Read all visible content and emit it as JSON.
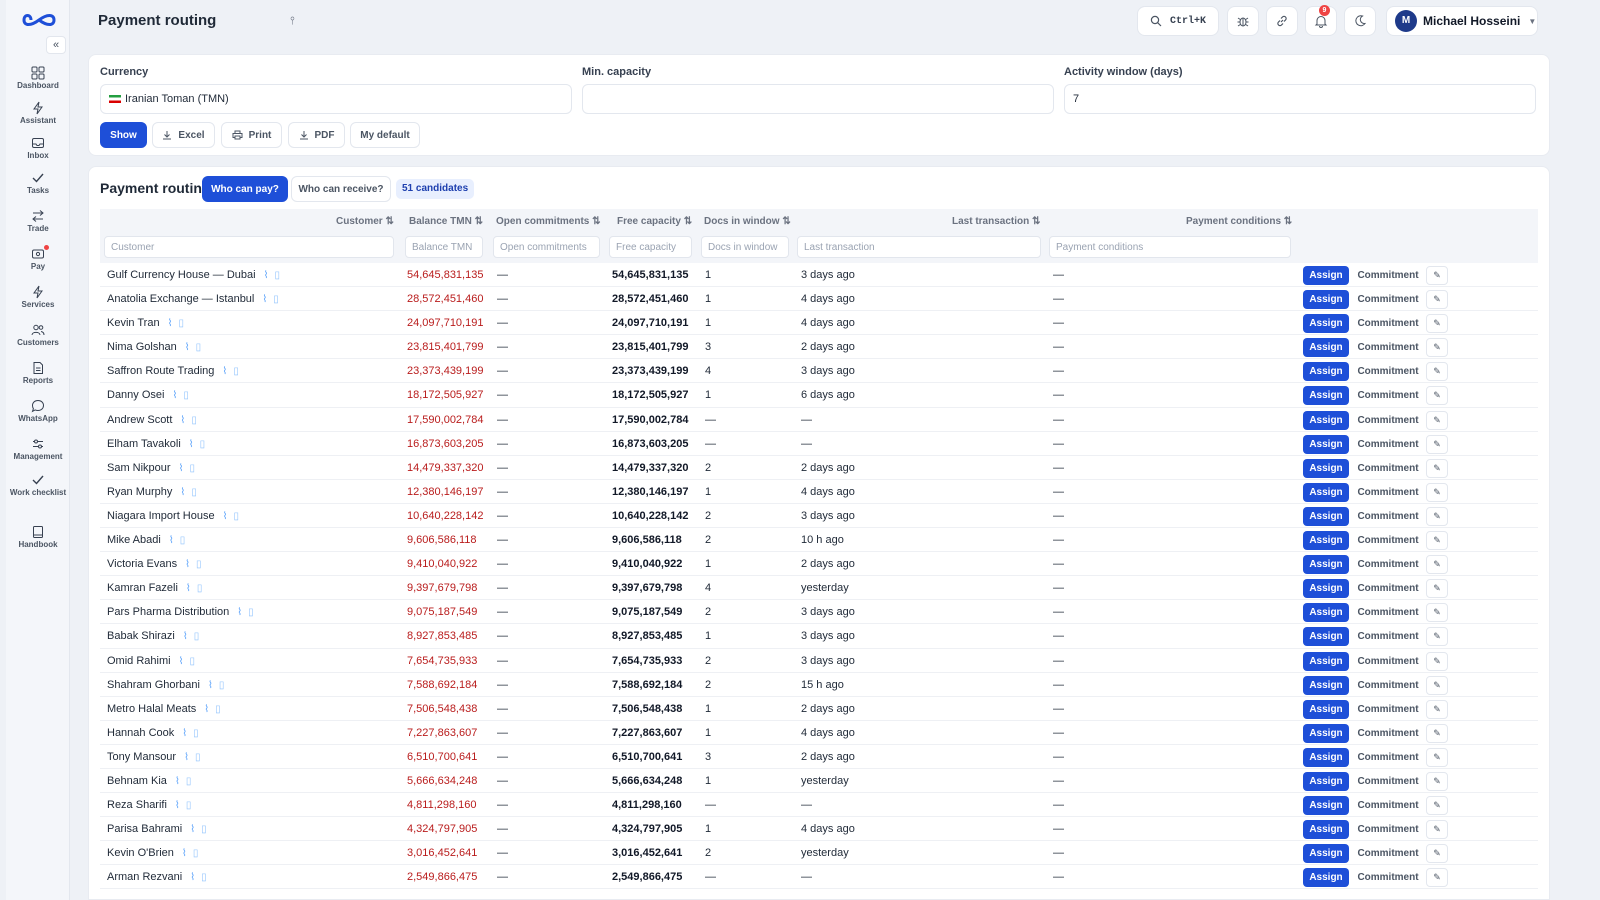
{
  "app": {
    "page_title": "Payment routing"
  },
  "sidebar": {
    "items": [
      {
        "label": "Dashboard",
        "icon": "dashboard-icon"
      },
      {
        "label": "Assistant",
        "icon": "bolt-icon"
      },
      {
        "label": "Inbox",
        "icon": "inbox-icon"
      },
      {
        "label": "Tasks",
        "icon": "check-icon"
      },
      {
        "label": "Trade",
        "icon": "swap-icon"
      },
      {
        "label": "Pay",
        "icon": "wallet-icon"
      },
      {
        "label": "Services",
        "icon": "bolt-icon"
      },
      {
        "label": "Customers",
        "icon": "users-icon"
      },
      {
        "label": "Reports",
        "icon": "report-icon"
      },
      {
        "label": "WhatsApp",
        "icon": "chat-icon"
      },
      {
        "label": "Management",
        "icon": "sliders-icon"
      },
      {
        "label": "Work checklist",
        "icon": "check-icon"
      },
      {
        "label": "Handbook",
        "icon": "book-icon"
      }
    ]
  },
  "header": {
    "search_shortcut": "Ctrl+K",
    "notification_count": "9",
    "user": {
      "initial": "M",
      "name": "Michael Hosseini"
    }
  },
  "filters": {
    "currency_label": "Currency",
    "currency_value": "Iranian Toman (TMN)",
    "min_capacity_label": "Min. capacity",
    "min_capacity_value": "",
    "activity_label": "Activity window (days)",
    "activity_value": "7",
    "buttons": {
      "show": "Show",
      "excel": "Excel",
      "print": "Print",
      "pdf": "PDF",
      "default": "My default"
    }
  },
  "table": {
    "title": "Payment routing",
    "tab_active": "Who can pay?",
    "tab_inactive": "Who can receive?",
    "candidates": "51 candidates",
    "columns": {
      "customer": "Customer ⇅",
      "balance": "Balance TMN ⇅",
      "open": "Open commitments ⇅",
      "free": "Free capacity ⇅",
      "docs": "Docs in window ⇅",
      "last": "Last transaction ⇅",
      "cond": "Payment conditions ⇅"
    },
    "placeholders": {
      "customer": "Customer",
      "balance": "Balance TMN",
      "open": "Open commitments",
      "free": "Free capacity",
      "docs": "Docs in window",
      "last": "Last transaction",
      "cond": "Payment conditions"
    },
    "action_labels": {
      "assign": "Assign",
      "commitment": "Commitment",
      "edit": "✎"
    },
    "rows": [
      {
        "name": "Gulf Currency House — Dubai",
        "balance": "54,645,831,135",
        "open": "—",
        "free": "54,645,831,135",
        "docs": "1",
        "last": "3 days ago",
        "cond": "—"
      },
      {
        "name": "Anatolia Exchange — Istanbul",
        "balance": "28,572,451,460",
        "open": "—",
        "free": "28,572,451,460",
        "docs": "1",
        "last": "4 days ago",
        "cond": "—"
      },
      {
        "name": "Kevin Tran",
        "balance": "24,097,710,191",
        "open": "—",
        "free": "24,097,710,191",
        "docs": "1",
        "last": "4 days ago",
        "cond": "—"
      },
      {
        "name": "Nima Golshan",
        "balance": "23,815,401,799",
        "open": "—",
        "free": "23,815,401,799",
        "docs": "3",
        "last": "2 days ago",
        "cond": "—"
      },
      {
        "name": "Saffron Route Trading",
        "balance": "23,373,439,199",
        "open": "—",
        "free": "23,373,439,199",
        "docs": "4",
        "last": "3 days ago",
        "cond": "—"
      },
      {
        "name": "Danny Osei",
        "balance": "18,172,505,927",
        "open": "—",
        "free": "18,172,505,927",
        "docs": "1",
        "last": "6 days ago",
        "cond": "—"
      },
      {
        "name": "Andrew Scott",
        "balance": "17,590,002,784",
        "open": "—",
        "free": "17,590,002,784",
        "docs": "—",
        "last": "—",
        "cond": "—"
      },
      {
        "name": "Elham Tavakoli",
        "balance": "16,873,603,205",
        "open": "—",
        "free": "16,873,603,205",
        "docs": "—",
        "last": "—",
        "cond": "—"
      },
      {
        "name": "Sam Nikpour",
        "balance": "14,479,337,320",
        "open": "—",
        "free": "14,479,337,320",
        "docs": "2",
        "last": "2 days ago",
        "cond": "—"
      },
      {
        "name": "Ryan Murphy",
        "balance": "12,380,146,197",
        "open": "—",
        "free": "12,380,146,197",
        "docs": "1",
        "last": "4 days ago",
        "cond": "—"
      },
      {
        "name": "Niagara Import House",
        "balance": "10,640,228,142",
        "open": "—",
        "free": "10,640,228,142",
        "docs": "2",
        "last": "3 days ago",
        "cond": "—"
      },
      {
        "name": "Mike Abadi",
        "balance": "9,606,586,118",
        "open": "—",
        "free": "9,606,586,118",
        "docs": "2",
        "last": "10 h ago",
        "cond": "—"
      },
      {
        "name": "Victoria Evans",
        "balance": "9,410,040,922",
        "open": "—",
        "free": "9,410,040,922",
        "docs": "1",
        "last": "2 days ago",
        "cond": "—"
      },
      {
        "name": "Kamran Fazeli",
        "balance": "9,397,679,798",
        "open": "—",
        "free": "9,397,679,798",
        "docs": "4",
        "last": "yesterday",
        "cond": "—"
      },
      {
        "name": "Pars Pharma Distribution",
        "balance": "9,075,187,549",
        "open": "—",
        "free": "9,075,187,549",
        "docs": "2",
        "last": "3 days ago",
        "cond": "—"
      },
      {
        "name": "Babak Shirazi",
        "balance": "8,927,853,485",
        "open": "—",
        "free": "8,927,853,485",
        "docs": "1",
        "last": "3 days ago",
        "cond": "—"
      },
      {
        "name": "Omid Rahimi",
        "balance": "7,654,735,933",
        "open": "—",
        "free": "7,654,735,933",
        "docs": "2",
        "last": "3 days ago",
        "cond": "—"
      },
      {
        "name": "Shahram Ghorbani",
        "balance": "7,588,692,184",
        "open": "—",
        "free": "7,588,692,184",
        "docs": "2",
        "last": "15 h ago",
        "cond": "—"
      },
      {
        "name": "Metro Halal Meats",
        "balance": "7,506,548,438",
        "open": "—",
        "free": "7,506,548,438",
        "docs": "1",
        "last": "2 days ago",
        "cond": "—"
      },
      {
        "name": "Hannah Cook",
        "balance": "7,227,863,607",
        "open": "—",
        "free": "7,227,863,607",
        "docs": "1",
        "last": "4 days ago",
        "cond": "—"
      },
      {
        "name": "Tony Mansour",
        "balance": "6,510,700,641",
        "open": "—",
        "free": "6,510,700,641",
        "docs": "3",
        "last": "2 days ago",
        "cond": "—"
      },
      {
        "name": "Behnam Kia",
        "balance": "5,666,634,248",
        "open": "—",
        "free": "5,666,634,248",
        "docs": "1",
        "last": "yesterday",
        "cond": "—"
      },
      {
        "name": "Reza Sharifi",
        "balance": "4,811,298,160",
        "open": "—",
        "free": "4,811,298,160",
        "docs": "—",
        "last": "—",
        "cond": "—"
      },
      {
        "name": "Parisa Bahrami",
        "balance": "4,324,797,905",
        "open": "—",
        "free": "4,324,797,905",
        "docs": "1",
        "last": "4 days ago",
        "cond": "—"
      },
      {
        "name": "Kevin O'Brien",
        "balance": "3,016,452,641",
        "open": "—",
        "free": "3,016,452,641",
        "docs": "2",
        "last": "yesterday",
        "cond": "—"
      },
      {
        "name": "Arman Rezvani",
        "balance": "2,549,866,475",
        "open": "—",
        "free": "2,549,866,475",
        "docs": "—",
        "last": "—",
        "cond": "—"
      }
    ]
  }
}
